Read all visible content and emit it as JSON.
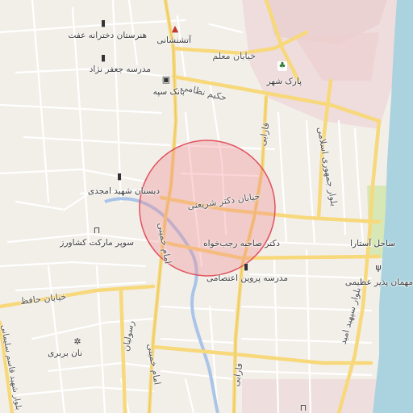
{
  "map": {
    "labels": {
      "girls_school": "هنرستان دخترانه عفت",
      "fire_station": "آتشنشانی",
      "muallem_street": "خیابان معلم",
      "jafar_nejad_school": "مدرسه جعفر نژاد",
      "sepah_bank": "بانک سپه",
      "hakim_nezami": "حکیم نظامی",
      "city_park": "پارک شهر",
      "farabi_north": "فارابی",
      "jomhouri_blvd": "بلوار جمهوری اسلامی",
      "shahid_amjadi_school": "دبستان شهید امجدی",
      "dr_shariati_street": "خیابان دکتر شریعتی",
      "imam_khomeini_north": "امام خمینی",
      "keshavarz_supermarket": "سوپر مارکت کشاورز",
      "dr_rajabkhah": "دکتر صاحبه رجب‌خواه",
      "astara_beach": "ساحل آستارا",
      "azimi_hotel": "مهمان پذیر عظیمی",
      "parvin_etesami_school": "مدرسه پروین اعتصامی",
      "hafez_street": "خیابان حافظ",
      "qasem_soleimani": "بلوار شهید قاسم سلیمانی",
      "rasoolian": "رسولیان",
      "barbari_bakery": "نان بربری",
      "imam_khomeini_south": "امام خمینی",
      "farabi_south": "فارابی",
      "amid_blvd": "بلوار سپهبد امید"
    },
    "icons": {
      "school": "school-icon",
      "fire": "fire-station-icon",
      "bank": "bank-icon",
      "park": "park-icon",
      "shop": "shopping-basket-icon",
      "restaurant": "restaurant-icon",
      "bakery": "bakery-icon"
    },
    "colors": {
      "background": "#f2efe9",
      "roads_major": "#f7d87a",
      "roads_minor": "#ffffff",
      "water": "#aad3df",
      "river": "#a9c4e8",
      "pink_area": "#f0dbdb",
      "green_strip": "#d8e8b8",
      "highlight_fill": "#f08a92",
      "highlight_stroke": "#e0525e"
    }
  }
}
